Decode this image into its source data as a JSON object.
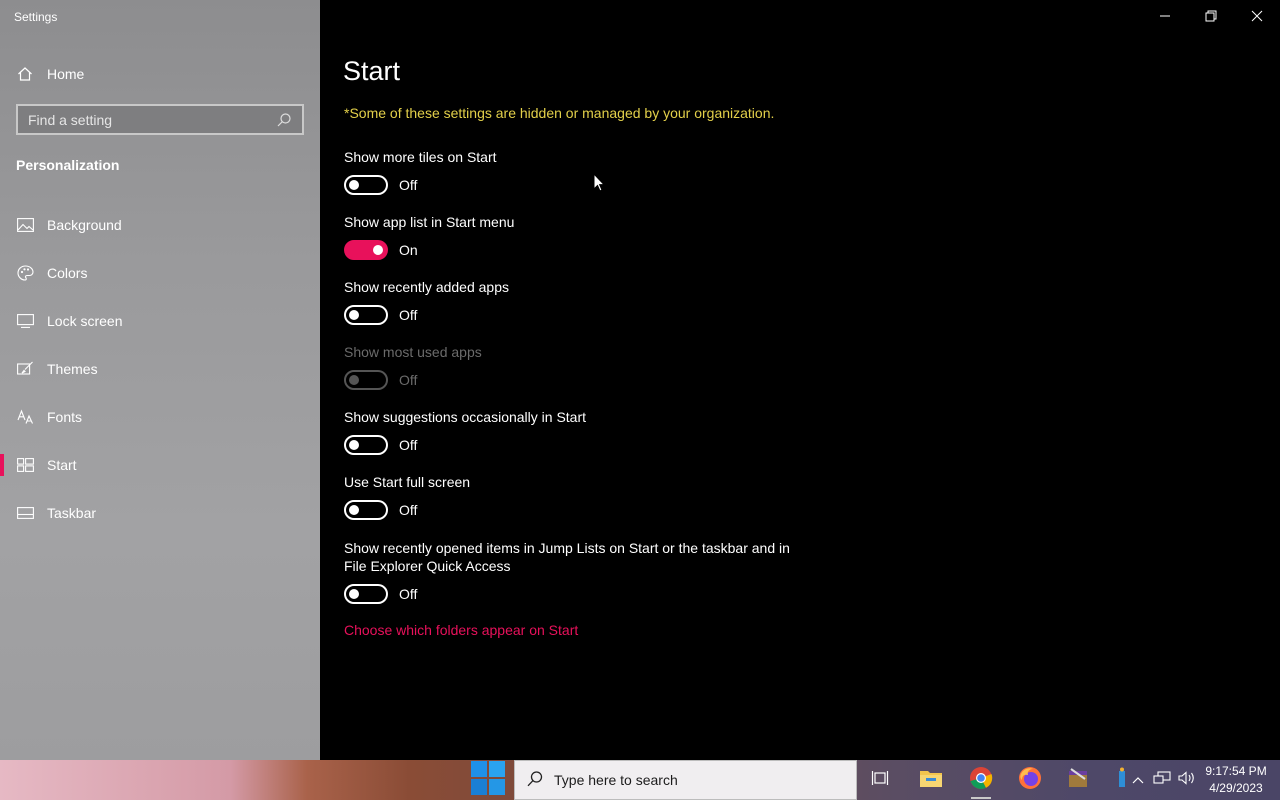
{
  "window": {
    "title": "Settings"
  },
  "sidebar": {
    "home_label": "Home",
    "search_placeholder": "Find a setting",
    "section_title": "Personalization",
    "items": [
      {
        "label": "Background",
        "icon": "image-icon"
      },
      {
        "label": "Colors",
        "icon": "palette-icon"
      },
      {
        "label": "Lock screen",
        "icon": "monitor-lock-icon"
      },
      {
        "label": "Themes",
        "icon": "brush-icon"
      },
      {
        "label": "Fonts",
        "icon": "font-icon"
      },
      {
        "label": "Start",
        "icon": "start-layout-icon",
        "active": true
      },
      {
        "label": "Taskbar",
        "icon": "taskbar-icon"
      }
    ]
  },
  "main": {
    "title": "Start",
    "notice": "*Some of these settings are hidden or managed by your organization.",
    "settings": [
      {
        "label": "Show more tiles on Start",
        "state": "Off"
      },
      {
        "label": "Show app list in Start menu",
        "state": "On"
      },
      {
        "label": "Show recently added apps",
        "state": "Off"
      },
      {
        "label": "Show most used apps",
        "state": "Off",
        "disabled": true
      },
      {
        "label": "Show suggestions occasionally in Start",
        "state": "Off"
      },
      {
        "label": "Use Start full screen",
        "state": "Off"
      },
      {
        "label": "Show recently opened items in Jump Lists on Start or the taskbar and in File Explorer Quick Access",
        "state": "Off"
      }
    ],
    "link": "Choose which folders appear on Start"
  },
  "taskbar": {
    "search_placeholder": "Type here to search",
    "time": "9:17:54 PM",
    "date": "4/29/2023"
  },
  "colors": {
    "accent": "#e8115b",
    "notice": "#e3d04a",
    "background": "#000000",
    "sidebar": "#9a9a9c"
  }
}
